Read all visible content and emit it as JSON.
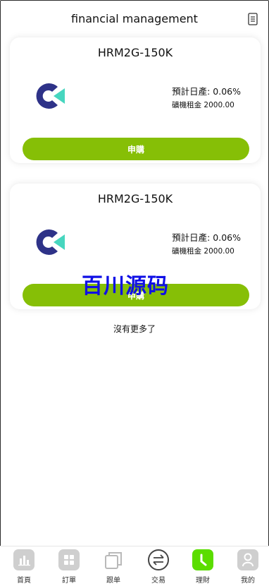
{
  "header": {
    "title": "financial management",
    "doc_icon": "document-icon"
  },
  "products": [
    {
      "name": "HRM2G-150K",
      "rate_label": "預計日產:",
      "rate_value": "0.06%",
      "rent_label": "礦機租金",
      "rent_value": "2000.00",
      "button_label": "申購"
    },
    {
      "name": "HRM2G-150K",
      "rate_label": "預計日產:",
      "rate_value": "0.06%",
      "rent_label": "礦機租金",
      "rent_value": "2000.00",
      "button_label": "申購"
    }
  ],
  "no_more": "沒有更多了",
  "watermark": "百川源码",
  "tabs": [
    {
      "label": "首頁",
      "icon": "bar-chart-icon"
    },
    {
      "label": "訂單",
      "icon": "grid-icon"
    },
    {
      "label": "跟单",
      "icon": "copy-icon"
    },
    {
      "label": "交易",
      "icon": "exchange-icon"
    },
    {
      "label": "理財",
      "icon": "clock-icon",
      "active": true
    },
    {
      "label": "我的",
      "icon": "user-icon"
    }
  ],
  "colors": {
    "accent": "#86bf06",
    "active_tab": "#5bdd00",
    "watermark": "#1010e6"
  }
}
